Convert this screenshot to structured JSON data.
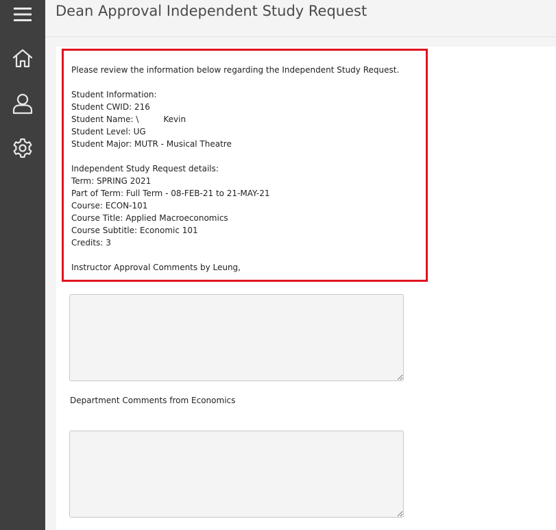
{
  "sidebar": {
    "menu_icon": "hamburger-menu-icon",
    "items": [
      {
        "name": "home",
        "icon": "home-icon"
      },
      {
        "name": "profile",
        "icon": "user-icon"
      },
      {
        "name": "settings",
        "icon": "gear-icon"
      }
    ]
  },
  "header": {
    "title": "Dean Approval Independent Study Request"
  },
  "info": {
    "intro": "Please review the information below regarding the Independent Study Request.",
    "student_heading": "Student Information:",
    "cwid": "Student CWID: 216",
    "name_prefix": "Student Name: \\",
    "name_first": "Kevin",
    "level": "Student Level: UG",
    "major": "Student Major: MUTR - Musical Theatre",
    "details_heading": "Independent Study Request details:",
    "term": "Term: SPRING 2021",
    "part_of_term": "Part of Term: Full Term - 08-FEB-21 to 21-MAY-21",
    "course": "Course: ECON-101",
    "course_title": "Course Title: Applied Macroeconomics",
    "course_subtitle": "Course Subtitle: Economic 101",
    "credits": "Credits: 3",
    "instructor_comments": "Instructor Approval Comments by Leung,"
  },
  "form": {
    "instructor_comment_value": "",
    "department_label": "Department Comments from Economics",
    "department_comment_value": ""
  },
  "colors": {
    "sidebar": "#3f3f3f",
    "highlight_border": "#e0131f",
    "background": "#f4f4f4"
  }
}
